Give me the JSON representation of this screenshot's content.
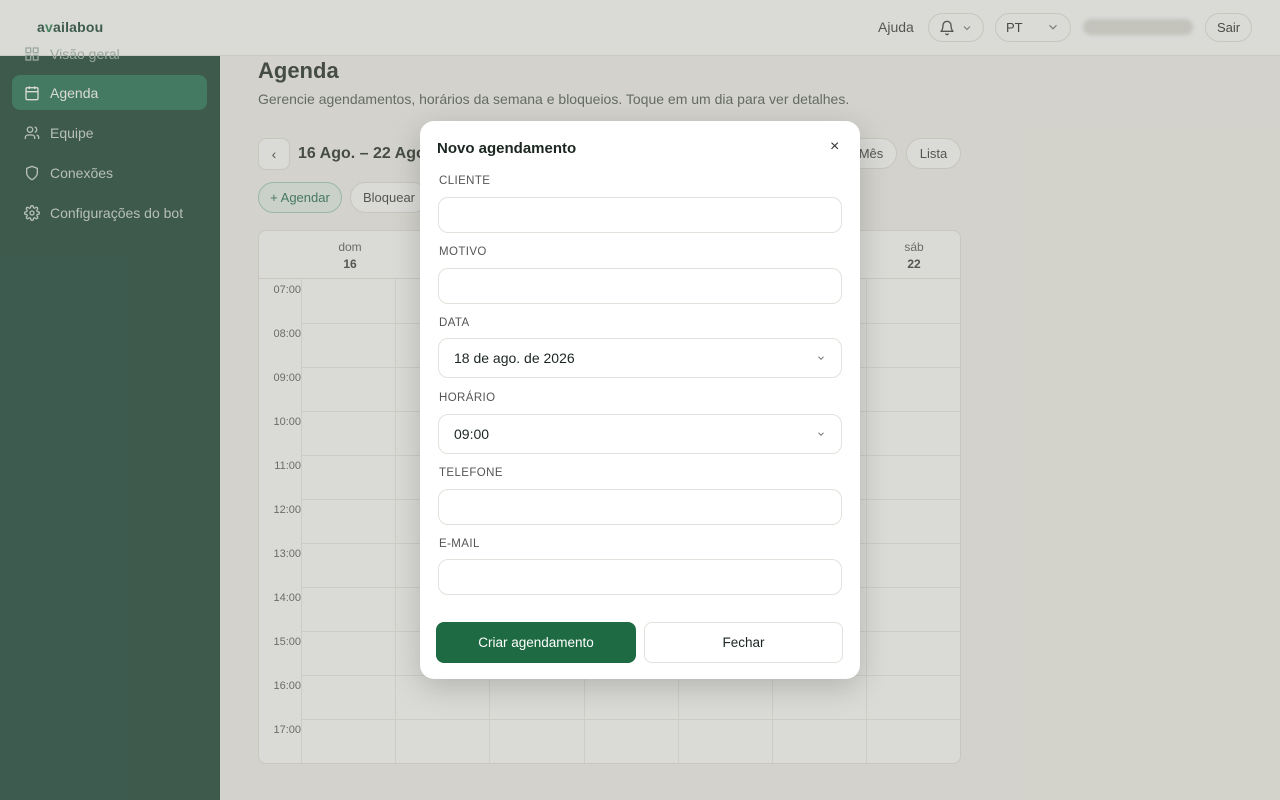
{
  "header": {
    "logo": {
      "prefix": "a",
      "accent": "v",
      "suffix": "ailabou"
    },
    "help": "Ajuda",
    "language": "PT",
    "signout": "Sair"
  },
  "sidebar": {
    "partial_item": "Visão geral",
    "items": [
      {
        "label": "Agenda",
        "icon": "calendar-icon",
        "active": true
      },
      {
        "label": "Equipe",
        "icon": "users-icon",
        "active": false
      },
      {
        "label": "Conexões",
        "icon": "shield-icon",
        "active": false
      },
      {
        "label": "Configurações do bot",
        "icon": "gear-icon",
        "active": false
      }
    ]
  },
  "main": {
    "title": "Agenda",
    "subtitle": "Gerencie agendamentos, horários da semana e bloqueios. Toque em um dia para ver detalhes.",
    "prev_label": "‹",
    "range": "16 Ago. – 22 Ago. 2",
    "views": {
      "month": "Mês",
      "list": "Lista"
    },
    "actions": {
      "add": "+ Agendar",
      "block": "Bloquear"
    },
    "calendar": {
      "days": [
        {
          "name": "dom",
          "num": "16"
        },
        {
          "name": "sáb",
          "num": "22"
        }
      ],
      "hours": [
        "07:00",
        "08:00",
        "09:00",
        "10:00",
        "11:00",
        "12:00",
        "13:00",
        "14:00",
        "15:00",
        "16:00",
        "17:00"
      ]
    }
  },
  "modal": {
    "title": "Novo agendamento",
    "close_icon": "×",
    "fields": {
      "client": {
        "label": "CLIENTE",
        "value": ""
      },
      "reason": {
        "label": "MOTIVO",
        "value": ""
      },
      "date": {
        "label": "DATA",
        "value": "18 de ago. de 2026"
      },
      "time": {
        "label": "HORÁRIO",
        "value": "09:00"
      },
      "phone": {
        "label": "TELEFONE",
        "value": ""
      },
      "email": {
        "label": "E-MAIL",
        "value": ""
      }
    },
    "create_button": "Criar agendamento",
    "close_button": "Fechar"
  },
  "colors": {
    "sidebar": "#0e3b2c",
    "active": "#1a6a4c",
    "primary": "#1e6b43"
  }
}
